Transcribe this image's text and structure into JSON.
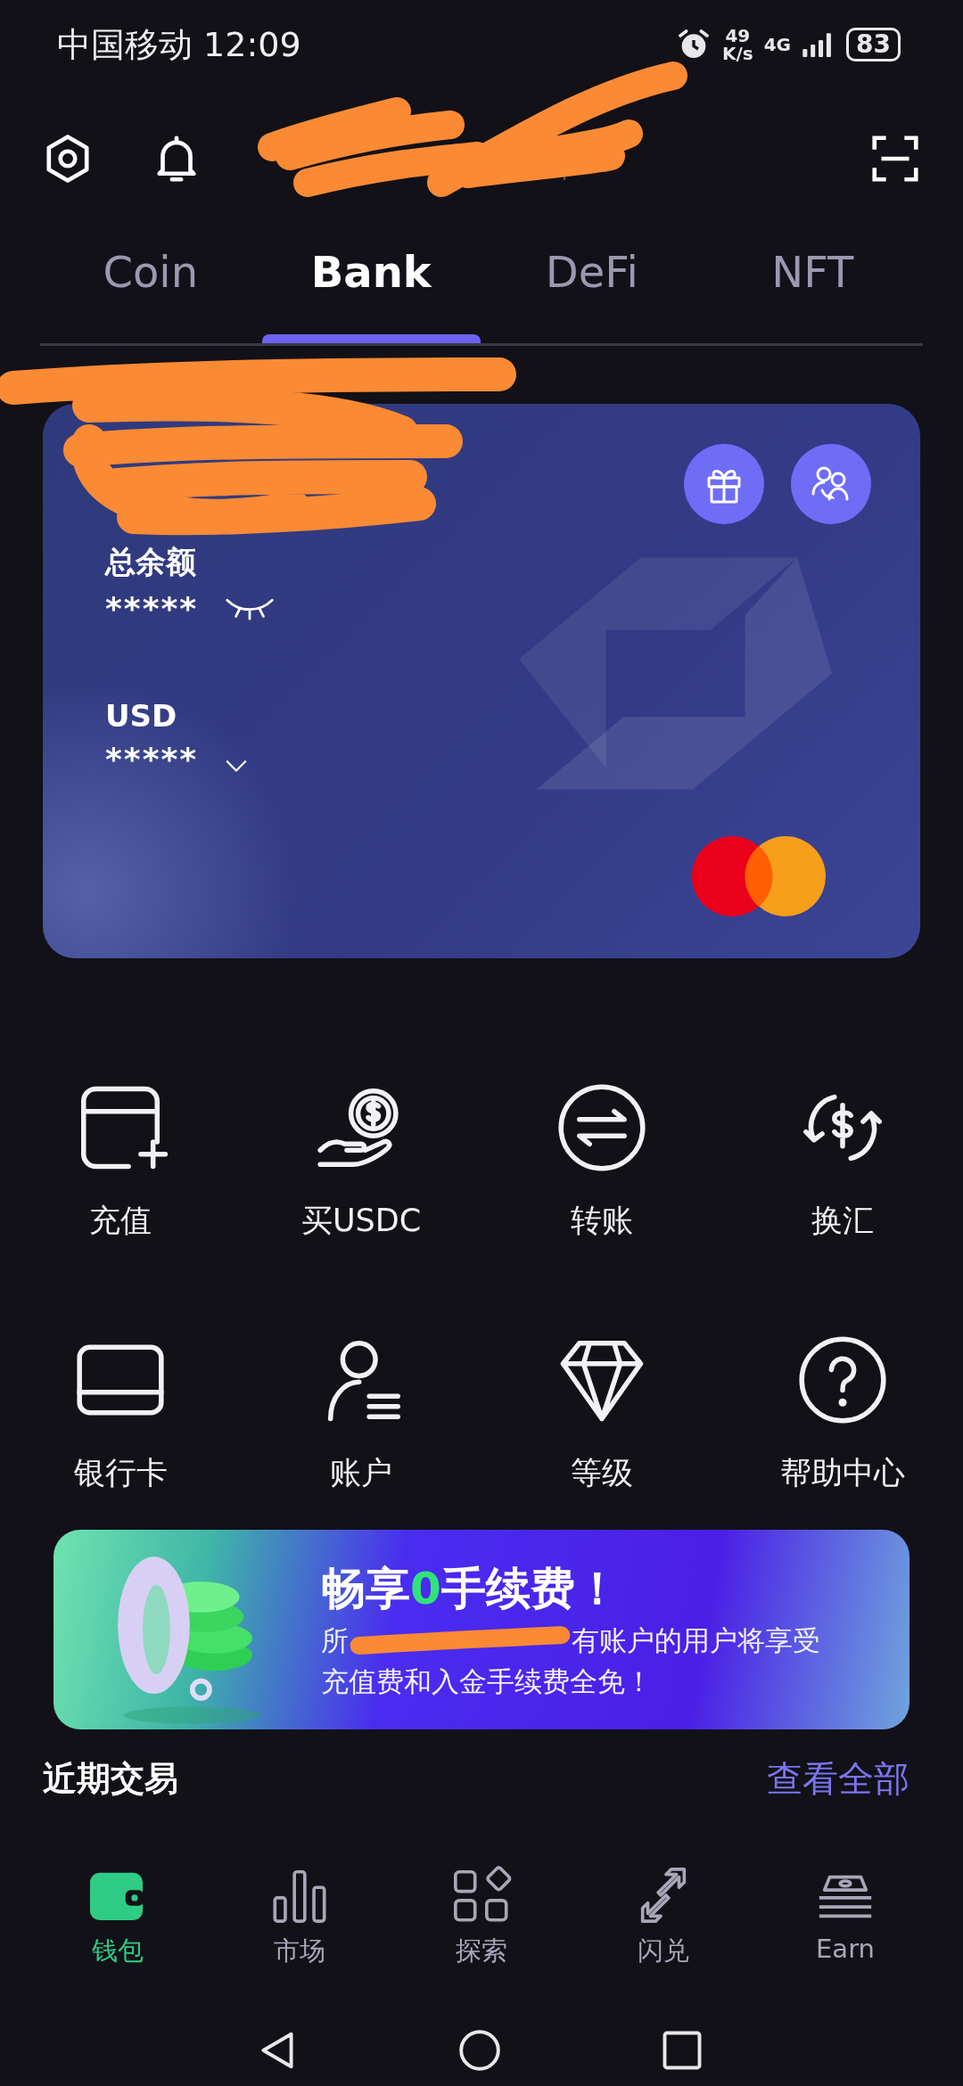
{
  "status_bar": {
    "carrier_time": "中国移动 12:09",
    "speed_value": "49",
    "speed_unit": "K/s",
    "network": "4G",
    "battery": "83"
  },
  "tabs": [
    {
      "label": "Coin",
      "selected": false
    },
    {
      "label": "Bank",
      "selected": true
    },
    {
      "label": "DeFi",
      "selected": false
    },
    {
      "label": "NFT",
      "selected": false
    }
  ],
  "card": {
    "balance_label": "总余额",
    "balance": "*****",
    "balance_hidden": true,
    "currency": "USD",
    "currency_amount": "*****"
  },
  "actions": [
    {
      "label": "充值",
      "kind": "top-up"
    },
    {
      "label": "买USDC",
      "kind": "buy"
    },
    {
      "label": "转账",
      "kind": "transfer"
    },
    {
      "label": "换汇",
      "kind": "exchange"
    },
    {
      "label": "银行卡",
      "kind": "bank-card"
    },
    {
      "label": "账户",
      "kind": "account"
    },
    {
      "label": "等级",
      "kind": "level"
    },
    {
      "label": "帮助中心",
      "kind": "help"
    }
  ],
  "promo": {
    "title_lead": "畅享",
    "title_highlight": "0",
    "title_tail": "手续费！",
    "line_1_start": "所",
    "line_1_end": "有账户的用户将享受",
    "line_2": "充值费和入金手续费全免！"
  },
  "recent": {
    "title": "近期交易",
    "link": "查看全部"
  },
  "nav": [
    {
      "label": "钱包",
      "kind": "wallet",
      "selected": true
    },
    {
      "label": "市场",
      "kind": "market",
      "selected": false
    },
    {
      "label": "探索",
      "kind": "explore",
      "selected": false
    },
    {
      "label": "闪兑",
      "kind": "swap",
      "selected": false
    },
    {
      "label": "Earn",
      "kind": "earn",
      "selected": false
    }
  ]
}
